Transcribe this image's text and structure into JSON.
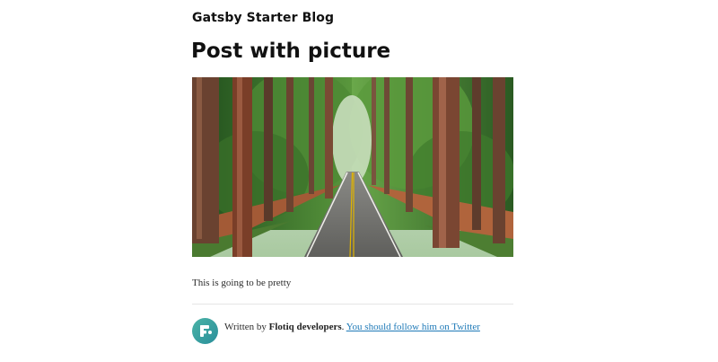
{
  "site": {
    "title": "Gatsby Starter Blog"
  },
  "post": {
    "title": "Post with picture",
    "image_alt": "Road through redwood forest",
    "body": "This is going to be pretty"
  },
  "bio": {
    "written_by": "Written by",
    "author": "Flotiq developers",
    "separator": ".",
    "link_label": "You should follow him on Twitter",
    "avatar_icon": "flotiq-logo-icon"
  },
  "colors": {
    "link": "#1f7ab8",
    "avatar_start": "#4ab3a6",
    "avatar_end": "#2a8f9b"
  }
}
